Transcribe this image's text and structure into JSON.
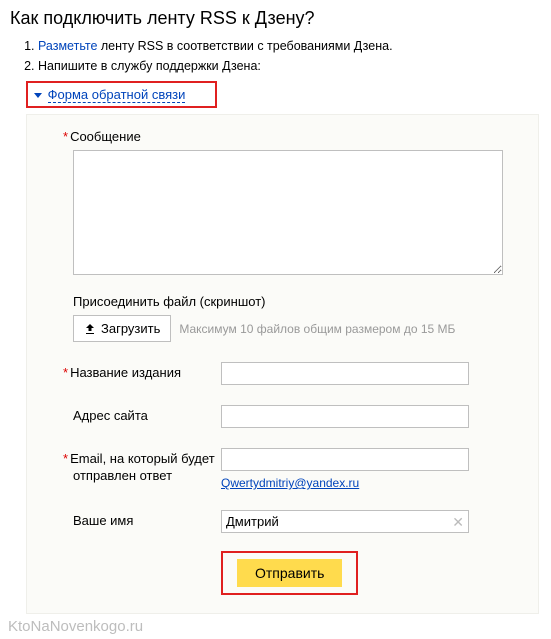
{
  "title": "Как подключить ленту RSS к Дзену?",
  "steps": [
    {
      "prefix": "",
      "link": "Разметьте",
      "suffix": " ленту RSS в соответствии с требованиями Дзена."
    },
    {
      "prefix": "Напишите в службу поддержки Дзена:",
      "link": "",
      "suffix": ""
    }
  ],
  "disclosure": "Форма обратной связи",
  "form": {
    "message_label": "Сообщение",
    "attach_label": "Присоединить файл (скриншот)",
    "upload_button": "Загрузить",
    "upload_hint": "Максимум 10 файлов общим размером до 15 МБ",
    "publication_label": "Название издания",
    "publication_value": "",
    "site_label": "Адрес сайта",
    "site_value": "",
    "email_label": "Email, на который будет отправлен ответ",
    "email_value": "",
    "email_hint_link": "Qwertydmitriy@yandex.ru",
    "name_label": "Ваше имя",
    "name_value": "Дмитрий",
    "submit": "Отправить"
  },
  "watermark": "KtoNaNovenkogo.ru"
}
